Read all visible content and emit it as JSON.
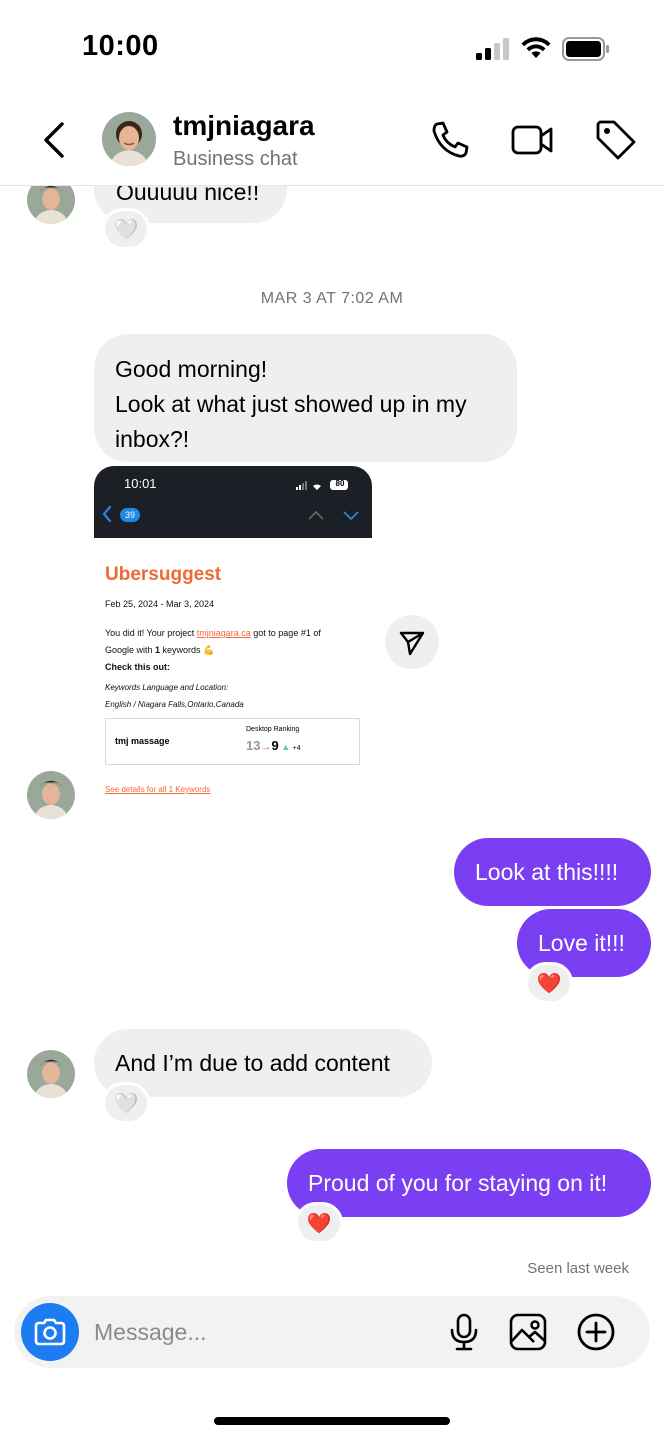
{
  "status_bar": {
    "time": "10:00"
  },
  "header": {
    "contact_name": "tmjniagara",
    "subtitle": "Business chat",
    "icons": [
      "back-chevron-icon",
      "phone-icon",
      "video-icon",
      "tag-icon"
    ]
  },
  "messages": {
    "m1_text": "Ouuuuu nice!!",
    "date_separator": "MAR 3 AT 7:02 AM",
    "m2_line1": "Good morning!",
    "m2_line2": "Look at what just showed up in my",
    "m2_line3": "inbox?!",
    "m3_text": "Look at this!!!!",
    "m4_text": "Love it!!!",
    "m5_text": "And I’m due to add content",
    "m6_text": "Proud of you for staying on it!",
    "seen_text": "Seen last week"
  },
  "attachment": {
    "time": "10:01",
    "battery": "80",
    "unread_count": "39",
    "brand": "Ubersuggest",
    "date_range": "Feb 25, 2024 - Mar 3, 2024",
    "line1_pre": "You did it! Your project ",
    "line1_link": "tmjniagara.ca",
    "line1_post": " got to page #1 of",
    "line2_pre": "Google with ",
    "line2_bold": "1",
    "line2_post": " keywords 💪",
    "check_out": "Check this out:",
    "kw_lang_label": "Keywords Language and Location:",
    "kw_lang_value": "English / Niagara Falls,Ontario,Canada",
    "table_keyword": "tmj massage",
    "table_header": "Desktop Ranking",
    "rank_from": "13",
    "rank_to": "9",
    "rank_delta": "+4",
    "details_link": "See details for all 1 Keywords"
  },
  "reactions": {
    "empty_heart": "🤍",
    "red_heart": "❤️"
  },
  "composer": {
    "placeholder": "Message...",
    "icons": [
      "camera-icon",
      "microphone-icon",
      "image-icon",
      "plus-circle-icon"
    ]
  },
  "colors": {
    "outgoing_bubble": "#7a3ff2",
    "incoming_bubble": "#efefef",
    "camera_button": "#1e7cf2",
    "brand_orange": "#f06a35"
  }
}
